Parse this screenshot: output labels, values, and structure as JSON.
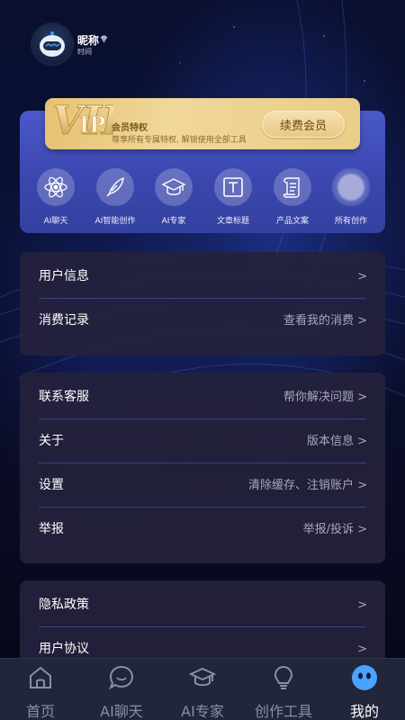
{
  "header": {
    "nickname": "昵称",
    "time_label": "时间"
  },
  "vip": {
    "logo_text": "VIP",
    "title": "会员特权",
    "subtitle": "尊享所有专属特权, 解锁使用全部工具",
    "renew_button": "续费会员"
  },
  "shortcuts": [
    {
      "label": "AI聊天",
      "icon": "atom-icon"
    },
    {
      "label": "AI智能创作",
      "icon": "feather-icon"
    },
    {
      "label": "AI专家",
      "icon": "graduation-cap-icon"
    },
    {
      "label": "文章标题",
      "icon": "title-t-icon"
    },
    {
      "label": "产品文案",
      "icon": "scroll-icon"
    },
    {
      "label": "所有创作",
      "icon": "more-icon"
    }
  ],
  "menu_group_1": [
    {
      "label": "用户信息",
      "value": ">"
    },
    {
      "label": "消费记录",
      "value": "查看我的消费 >"
    }
  ],
  "menu_group_2": [
    {
      "label": "联系客服",
      "value": "帮你解决问题 >"
    },
    {
      "label": "关于",
      "value": "版本信息 >"
    },
    {
      "label": "设置",
      "value": "清除缓存、注销账户 >"
    },
    {
      "label": "举报",
      "value": "举报/投诉 >"
    }
  ],
  "menu_group_3": [
    {
      "label": "隐私政策",
      "value": ">"
    },
    {
      "label": "用户协议",
      "value": ">"
    }
  ],
  "tabbar": [
    {
      "label": "首页",
      "icon": "home-icon"
    },
    {
      "label": "AI聊天",
      "icon": "chat-bubble-icon"
    },
    {
      "label": "AI专家",
      "icon": "graduation-cap-icon"
    },
    {
      "label": "创作工具",
      "icon": "lightbulb-icon"
    },
    {
      "label": "我的",
      "icon": "robot-face-icon",
      "active": true
    }
  ],
  "colors": {
    "accent_card": "#4a58c9",
    "vip_gold": "#e6c373",
    "tab_active": "#ffffff",
    "tab_inactive": "#8a8ea8"
  }
}
